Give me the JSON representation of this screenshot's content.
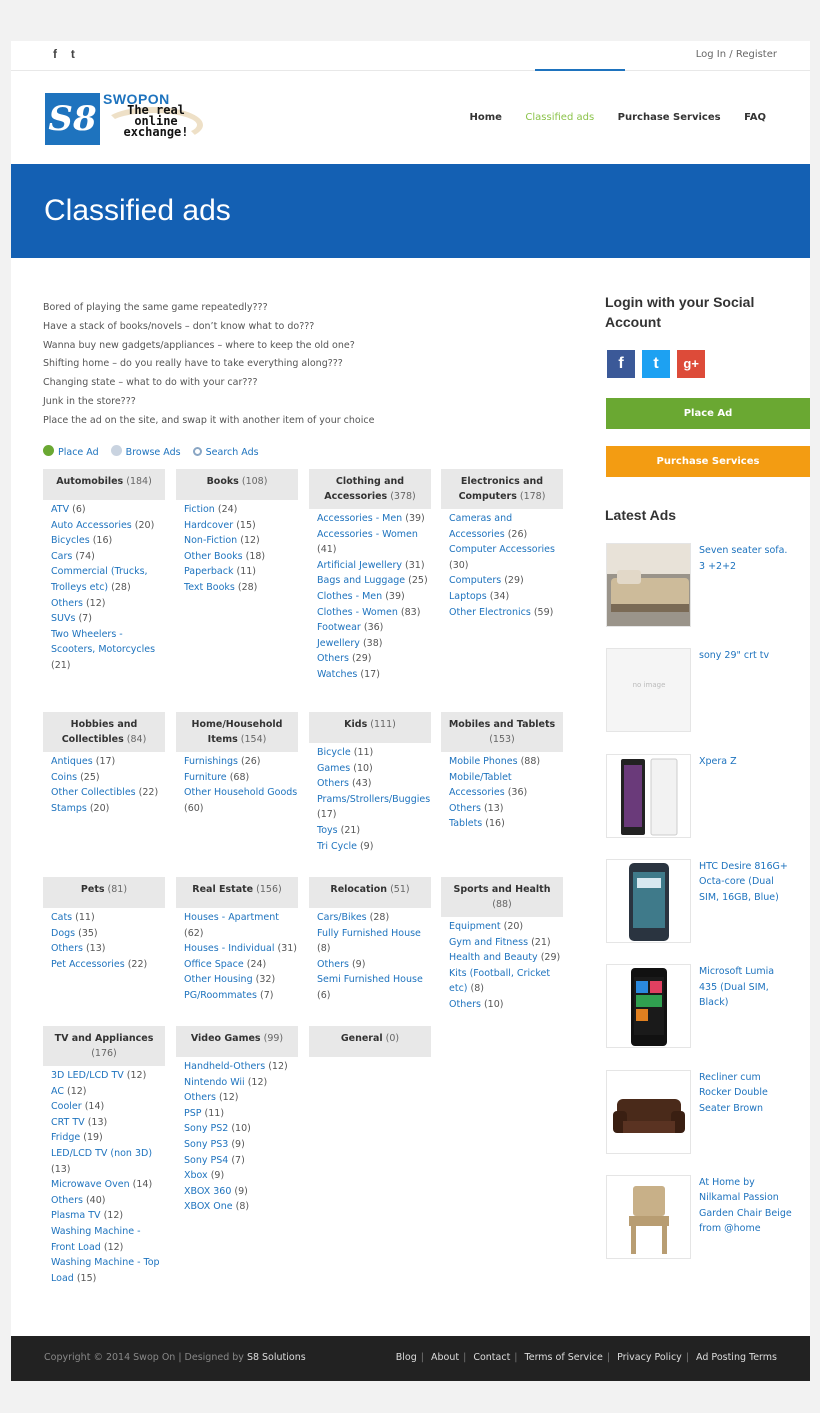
{
  "topbar": {
    "social": [
      "f",
      "t"
    ],
    "login": "Log In / Register"
  },
  "logo": {
    "mark": "S8",
    "name": "SWOPON",
    "tagline": "The real online exchange!"
  },
  "nav": [
    "Home",
    "Classified ads",
    "Purchase Services",
    "FAQ"
  ],
  "banner": {
    "title": "Classified ads"
  },
  "intro": [
    "Bored of playing the same game repeatedly???",
    "Have a stack of books/novels – don’t know what to do???",
    "Wanna buy new gadgets/appliances – where to keep the old one?",
    "Shifting home – do you really have to take everything along???",
    "Changing state – what to do with your car???",
    "Junk in the store???",
    "Place the ad on the site, and swap it with another item of your choice"
  ],
  "quick_links": [
    "Place Ad",
    "Browse Ads",
    "Search Ads"
  ],
  "categories": [
    {
      "name": "Automobiles",
      "count": "(184)",
      "items": [
        [
          "ATV",
          "(6)"
        ],
        [
          "Auto Accessories",
          "(20)"
        ],
        [
          "Bicycles",
          "(16)"
        ],
        [
          "Cars",
          "(74)"
        ],
        [
          "Commercial (Trucks, Trolleys etc)",
          "(28)"
        ],
        [
          "Others",
          "(12)"
        ],
        [
          "SUVs",
          "(7)"
        ],
        [
          "Two Wheelers - Scooters, Motorcycles",
          "(21)"
        ]
      ]
    },
    {
      "name": "Books",
      "count": "(108)",
      "items": [
        [
          "Fiction",
          "(24)"
        ],
        [
          "Hardcover",
          "(15)"
        ],
        [
          "Non-Fiction",
          "(12)"
        ],
        [
          "Other Books",
          "(18)"
        ],
        [
          "Paperback",
          "(11)"
        ],
        [
          "Text Books",
          "(28)"
        ]
      ]
    },
    {
      "name": "Clothing and Accessories",
      "count": "(378)",
      "items": [
        [
          "Accessories - Men",
          "(39)"
        ],
        [
          "Accessories - Women",
          "(41)"
        ],
        [
          "Artificial Jewellery",
          "(31)"
        ],
        [
          "Bags and Luggage",
          "(25)"
        ],
        [
          "Clothes - Men",
          "(39)"
        ],
        [
          "Clothes - Women",
          "(83)"
        ],
        [
          "Footwear",
          "(36)"
        ],
        [
          "Jewellery",
          "(38)"
        ],
        [
          "Others",
          "(29)"
        ],
        [
          "Watches",
          "(17)"
        ]
      ]
    },
    {
      "name": "Electronics and Computers",
      "count": "(178)",
      "items": [
        [
          "Cameras and Accessories",
          "(26)"
        ],
        [
          "Computer Accessories",
          "(30)"
        ],
        [
          "Computers",
          "(29)"
        ],
        [
          "Laptops",
          "(34)"
        ],
        [
          "Other Electronics",
          "(59)"
        ]
      ]
    },
    {
      "name": "Hobbies and Collectibles",
      "count": "(84)",
      "items": [
        [
          "Antiques",
          "(17)"
        ],
        [
          "Coins",
          "(25)"
        ],
        [
          "Other Collectibles",
          "(22)"
        ],
        [
          "Stamps",
          "(20)"
        ]
      ]
    },
    {
      "name": "Home/Household Items",
      "count": "(154)",
      "items": [
        [
          "Furnishings",
          "(26)"
        ],
        [
          "Furniture",
          "(68)"
        ],
        [
          "Other Household Goods",
          "(60)"
        ]
      ]
    },
    {
      "name": "Kids",
      "count": "(111)",
      "items": [
        [
          "Bicycle",
          "(11)"
        ],
        [
          "Games",
          "(10)"
        ],
        [
          "Others",
          "(43)"
        ],
        [
          "Prams/Strollers/Buggies",
          "(17)"
        ],
        [
          "Toys",
          "(21)"
        ],
        [
          "Tri Cycle",
          "(9)"
        ]
      ]
    },
    {
      "name": "Mobiles and Tablets",
      "count": "(153)",
      "items": [
        [
          "Mobile Phones",
          "(88)"
        ],
        [
          "Mobile/Tablet Accessories",
          "(36)"
        ],
        [
          "Others",
          "(13)"
        ],
        [
          "Tablets",
          "(16)"
        ]
      ]
    },
    {
      "name": "Pets",
      "count": "(81)",
      "items": [
        [
          "Cats",
          "(11)"
        ],
        [
          "Dogs",
          "(35)"
        ],
        [
          "Others",
          "(13)"
        ],
        [
          "Pet Accessories",
          "(22)"
        ]
      ]
    },
    {
      "name": "Real Estate",
      "count": "(156)",
      "items": [
        [
          "Houses - Apartment",
          "(62)"
        ],
        [
          "Houses - Individual",
          "(31)"
        ],
        [
          "Office Space",
          "(24)"
        ],
        [
          "Other Housing",
          "(32)"
        ],
        [
          "PG/Roommates",
          "(7)"
        ]
      ]
    },
    {
      "name": "Relocation",
      "count": "(51)",
      "items": [
        [
          "Cars/Bikes",
          "(28)"
        ],
        [
          "Fully Furnished House",
          "(8)"
        ],
        [
          "Others",
          "(9)"
        ],
        [
          "Semi Furnished House",
          "(6)"
        ]
      ]
    },
    {
      "name": "Sports and Health",
      "count": "(88)",
      "items": [
        [
          "Equipment",
          "(20)"
        ],
        [
          "Gym and Fitness",
          "(21)"
        ],
        [
          "Health and Beauty",
          "(29)"
        ],
        [
          "Kits (Football, Cricket etc)",
          "(8)"
        ],
        [
          "Others",
          "(10)"
        ]
      ]
    },
    {
      "name": "TV and Appliances",
      "count": "(176)",
      "items": [
        [
          "3D LED/LCD TV",
          "(12)"
        ],
        [
          "AC",
          "(12)"
        ],
        [
          "Cooler",
          "(14)"
        ],
        [
          "CRT TV",
          "(13)"
        ],
        [
          "Fridge",
          "(19)"
        ],
        [
          "LED/LCD TV (non 3D)",
          "(13)"
        ],
        [
          "Microwave Oven",
          "(14)"
        ],
        [
          "Others",
          "(40)"
        ],
        [
          "Plasma TV",
          "(12)"
        ],
        [
          "Washing Machine - Front Load",
          "(12)"
        ],
        [
          "Washing Machine - Top Load",
          "(15)"
        ]
      ]
    },
    {
      "name": "Video Games",
      "count": "(99)",
      "items": [
        [
          "Handheld-Others",
          "(12)"
        ],
        [
          "Nintendo Wii",
          "(12)"
        ],
        [
          "Others",
          "(12)"
        ],
        [
          "PSP",
          "(11)"
        ],
        [
          "Sony PS2",
          "(10)"
        ],
        [
          "Sony PS3",
          "(9)"
        ],
        [
          "Sony PS4",
          "(7)"
        ],
        [
          "Xbox",
          "(9)"
        ],
        [
          "XBOX 360",
          "(9)"
        ],
        [
          "XBOX One",
          "(8)"
        ]
      ]
    },
    {
      "name": "General",
      "count": "(0)",
      "items": []
    }
  ],
  "sidebar": {
    "login_title": "Login with your Social Account",
    "place_ad": "Place Ad",
    "purchase_services": "Purchase Services",
    "latest_title": "Latest Ads",
    "no_image": "no image",
    "latest": [
      {
        "title": "Seven seater sofa. 3 +2+2",
        "thumb": "sofa"
      },
      {
        "title": "sony 29\" crt tv",
        "thumb": "none"
      },
      {
        "title": "Xpera Z",
        "thumb": "phones"
      },
      {
        "title": "HTC Desire 816G+ Octa-core (Dual SIM, 16GB, Blue)",
        "thumb": "phone"
      },
      {
        "title": "Microsoft Lumia 435 (Dual SIM, Black)",
        "thumb": "lumia"
      },
      {
        "title": "Recliner cum Rocker Double Seater Brown",
        "thumb": "recliner"
      },
      {
        "title": "At Home by Nilkamal Passion Garden Chair Beige from @home",
        "thumb": "chair"
      }
    ]
  },
  "footer": {
    "copyright": "Copyright © 2014 Swop On | Designed by",
    "designer": "S8 Solutions",
    "links": [
      "Blog",
      "About",
      "Contact",
      "Terms of Service",
      "Privacy Policy",
      "Ad Posting Terms"
    ]
  },
  "colors": {
    "brand_blue": "#1460b3",
    "link": "#1e73be",
    "green": "#6aa832",
    "orange": "#f39c12",
    "nav_active": "#8bc34a"
  }
}
